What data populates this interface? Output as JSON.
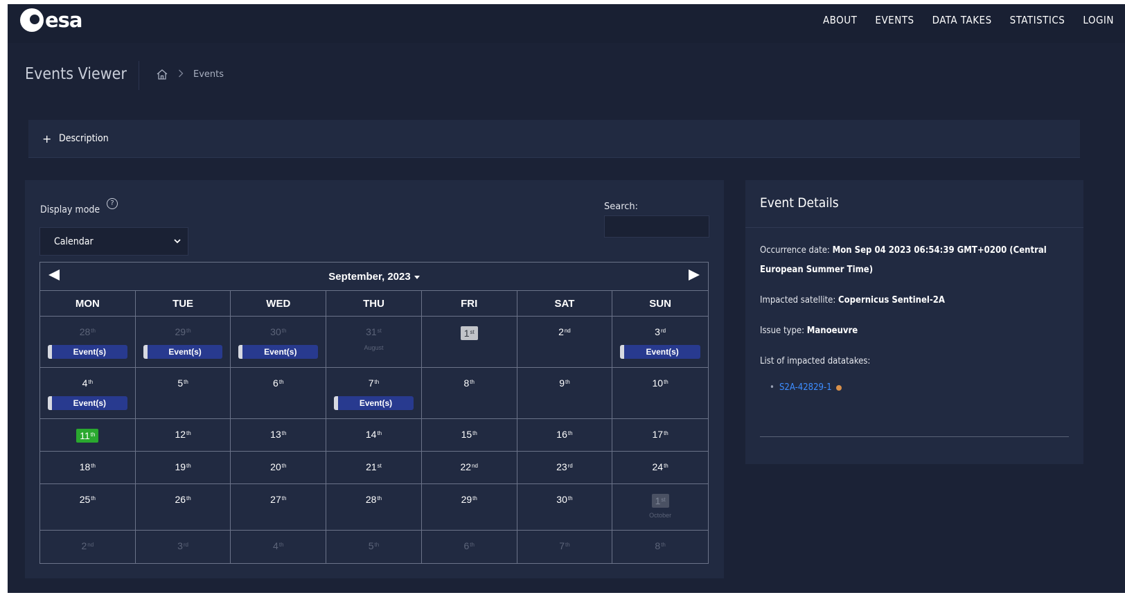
{
  "brand": {
    "logo_text": "esa"
  },
  "nav": {
    "items": [
      "ABOUT",
      "EVENTS",
      "DATA TAKES",
      "STATISTICS",
      "LOGIN"
    ]
  },
  "header": {
    "title": "Events Viewer",
    "breadcrumb": [
      "Events"
    ]
  },
  "description": {
    "toggle": "+",
    "label": "Description"
  },
  "controls": {
    "display_mode_label": "Display mode",
    "help": "?",
    "display_mode_value": "Calendar",
    "search_label": "Search:",
    "search_value": ""
  },
  "calendar": {
    "month_label": "September, 2023",
    "weekdays": [
      "MON",
      "TUE",
      "WED",
      "THU",
      "FRI",
      "SAT",
      "SUN"
    ],
    "event_label": "Event(s)",
    "weeks": [
      [
        {
          "n": "28",
          "s": "th",
          "other": true,
          "event": true
        },
        {
          "n": "29",
          "s": "th",
          "other": true,
          "event": true
        },
        {
          "n": "30",
          "s": "th",
          "other": true,
          "event": true
        },
        {
          "n": "31",
          "s": "st",
          "other": true,
          "note": "August"
        },
        {
          "n": "1",
          "s": "st",
          "chip": "grey"
        },
        {
          "n": "2",
          "s": "nd"
        },
        {
          "n": "3",
          "s": "rd",
          "event": true
        }
      ],
      [
        {
          "n": "4",
          "s": "th",
          "event": true
        },
        {
          "n": "5",
          "s": "th"
        },
        {
          "n": "6",
          "s": "th"
        },
        {
          "n": "7",
          "s": "th",
          "event": true
        },
        {
          "n": "8",
          "s": "th"
        },
        {
          "n": "9",
          "s": "th"
        },
        {
          "n": "10",
          "s": "th"
        }
      ],
      [
        {
          "n": "11",
          "s": "th",
          "chip": "green"
        },
        {
          "n": "12",
          "s": "th"
        },
        {
          "n": "13",
          "s": "th"
        },
        {
          "n": "14",
          "s": "th"
        },
        {
          "n": "15",
          "s": "th"
        },
        {
          "n": "16",
          "s": "th"
        },
        {
          "n": "17",
          "s": "th"
        }
      ],
      [
        {
          "n": "18",
          "s": "th"
        },
        {
          "n": "19",
          "s": "th"
        },
        {
          "n": "20",
          "s": "th"
        },
        {
          "n": "21",
          "s": "st"
        },
        {
          "n": "22",
          "s": "nd"
        },
        {
          "n": "23",
          "s": "rd"
        },
        {
          "n": "24",
          "s": "th"
        }
      ],
      [
        {
          "n": "25",
          "s": "th"
        },
        {
          "n": "26",
          "s": "th"
        },
        {
          "n": "27",
          "s": "th"
        },
        {
          "n": "28",
          "s": "th"
        },
        {
          "n": "29",
          "s": "th"
        },
        {
          "n": "30",
          "s": "th"
        },
        {
          "n": "1",
          "s": "st",
          "other": true,
          "chip": "dim",
          "note": "October"
        }
      ],
      [
        {
          "n": "2",
          "s": "nd",
          "other": true
        },
        {
          "n": "3",
          "s": "rd",
          "other": true
        },
        {
          "n": "4",
          "s": "th",
          "other": true
        },
        {
          "n": "5",
          "s": "th",
          "other": true
        },
        {
          "n": "6",
          "s": "th",
          "other": true
        },
        {
          "n": "7",
          "s": "th",
          "other": true
        },
        {
          "n": "8",
          "s": "th",
          "other": true
        }
      ]
    ]
  },
  "details": {
    "title": "Event Details",
    "occurrence_label": "Occurrence date:",
    "occurrence_value": "Mon Sep 04 2023 06:54:39 GMT+0200 (Central European Summer Time)",
    "satellite_label": "Impacted satellite:",
    "satellite_value": "Copernicus Sentinel-2A",
    "issue_label": "Issue type:",
    "issue_value": "Manoeuvre",
    "datatakes_label": "List of impacted datatakes:",
    "datatakes": [
      "S2A-42829-1"
    ]
  },
  "colors": {
    "background": "#1b2236",
    "card": "#212a41",
    "event_pill": "#283a8f",
    "today": "#2aa82f",
    "link": "#3d8dff",
    "status_dot": "#d9904a"
  }
}
